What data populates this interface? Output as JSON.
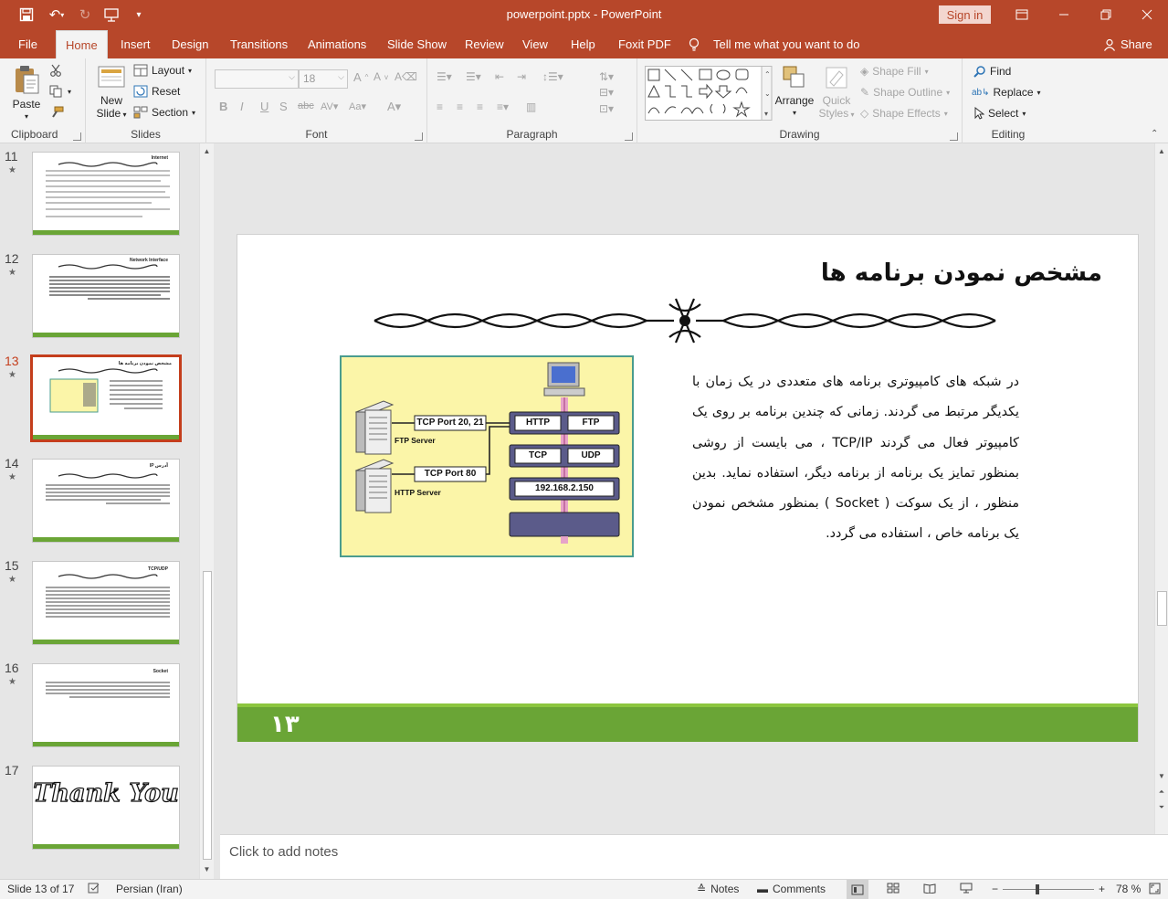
{
  "window": {
    "title": "powerpoint.pptx  -  PowerPoint",
    "sign_in": "Sign in"
  },
  "tabs": [
    {
      "label": "File"
    },
    {
      "label": "Home"
    },
    {
      "label": "Insert"
    },
    {
      "label": "Design"
    },
    {
      "label": "Transitions"
    },
    {
      "label": "Animations"
    },
    {
      "label": "Slide Show"
    },
    {
      "label": "Review"
    },
    {
      "label": "View"
    },
    {
      "label": "Help"
    },
    {
      "label": "Foxit PDF"
    }
  ],
  "tell_me": "Tell me what you want to do",
  "share": "Share",
  "ribbon": {
    "clipboard": {
      "label": "Clipboard",
      "paste": "Paste"
    },
    "slides": {
      "label": "Slides",
      "new_slide_1": "New",
      "new_slide_2": "Slide",
      "layout": "Layout",
      "reset": "Reset",
      "section": "Section"
    },
    "font": {
      "label": "Font",
      "size": "18"
    },
    "paragraph": {
      "label": "Paragraph"
    },
    "drawing": {
      "label": "Drawing",
      "arrange": "Arrange",
      "quick_styles_1": "Quick",
      "quick_styles_2": "Styles",
      "shape_fill": "Shape Fill",
      "shape_outline": "Shape Outline",
      "shape_effects": "Shape Effects"
    },
    "editing": {
      "label": "Editing",
      "find": "Find",
      "replace": "Replace",
      "select": "Select"
    }
  },
  "thumbnails": [
    {
      "num": "11",
      "title": "Internet"
    },
    {
      "num": "12",
      "title": "Network Interface"
    },
    {
      "num": "13",
      "title": "مشخص نمودن برنامه ها"
    },
    {
      "num": "14",
      "title": "آدرس IP"
    },
    {
      "num": "15",
      "title": "TCP/UDP"
    },
    {
      "num": "16",
      "title": "Socket"
    },
    {
      "num": "17",
      "title": "Thank You"
    }
  ],
  "slide": {
    "title": "مشخص نمودن برنامه ها",
    "body": "در شبکه های کامپیوتری برنامه های متعددی در یک زمان با یکدیگر مرتبط می گردند. زمانی که چندین برنامه بر روی یک کامپیوتر فعال می گردند TCP/IP ، می بایست از روشی بمنظور تمایز یک برنامه از برنامه دیگر، استفاده نماید. بدین منظور ، از یک سوکت ( Socket ) بمنظور مشخص نمودن یک برنامه خاص ، استفاده می گردد.",
    "number": "۱۳",
    "diagram": {
      "port_ftp": "TCP Port 20, 21",
      "port_http": "TCP Port 80",
      "ftp_server": "FTP Server",
      "http_server": "HTTP Server",
      "http": "HTTP",
      "ftp": "FTP",
      "tcp": "TCP",
      "udp": "UDP",
      "ip": "192.168.2.150"
    }
  },
  "notes_placeholder": "Click to add notes",
  "status": {
    "slide_info": "Slide 13 of 17",
    "language": "Persian (Iran)",
    "notes": "Notes",
    "comments": "Comments",
    "zoom": "78 %"
  }
}
